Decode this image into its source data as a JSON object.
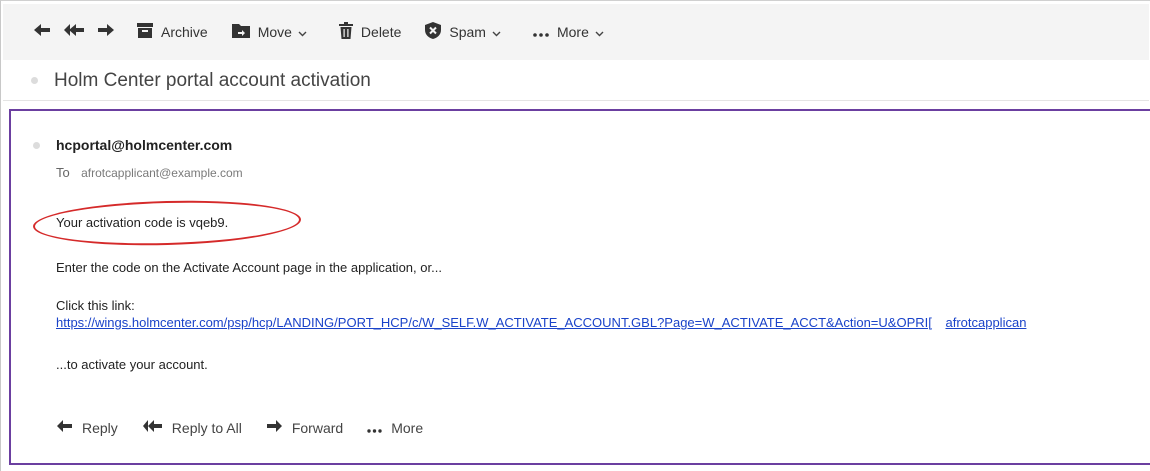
{
  "toolbar": {
    "archive": "Archive",
    "move": "Move",
    "delete": "Delete",
    "spam": "Spam",
    "more": "More"
  },
  "subject": "Holm Center portal account activation",
  "message": {
    "sender": "hcportal@holmcenter.com",
    "to_label": "To",
    "to_address": "afrotcapplicant@example.com",
    "line1": "Your activation code is vqeb9.",
    "line2": "Enter the code on the Activate Account page in the application, or...",
    "line3": "Click this link:",
    "link_url": "https://wings.holmcenter.com/psp/hcp/LANDING/PORT_HCP/c/W_SELF.W_ACTIVATE_ACCOUNT.GBL?Page=W_ACTIVATE_ACCT&Action=U&OPRI[",
    "link_tail": "afrotcapplican",
    "line4": "...to activate your account."
  },
  "actions": {
    "reply": "Reply",
    "reply_all": "Reply to All",
    "forward": "Forward",
    "more": "More"
  },
  "colors": {
    "accent_border": "#6b3fa0",
    "link": "#1a43c9",
    "annotation": "#d52a2a"
  },
  "icons": [
    "reply-icon",
    "reply-all-icon",
    "forward-icon",
    "archive-icon",
    "move-icon",
    "delete-icon",
    "spam-icon",
    "more-icon",
    "chevron-down-icon"
  ]
}
